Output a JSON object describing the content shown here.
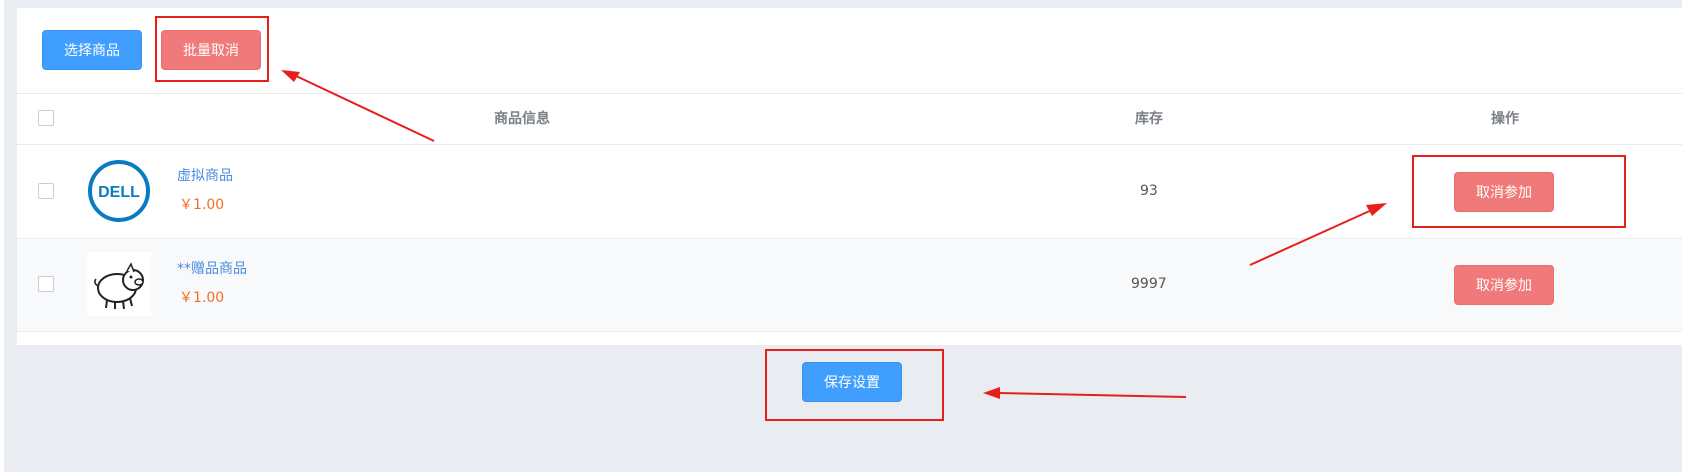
{
  "toolbar": {
    "select_label": "选择商品",
    "batch_cancel_label": "批量取消"
  },
  "table": {
    "headers": {
      "product_info": "商品信息",
      "stock": "库存",
      "action": "操作"
    },
    "rows": [
      {
        "logo": "dell-logo",
        "name": "虚拟商品",
        "price": "￥1.00",
        "stock": "93",
        "action_label": "取消参加"
      },
      {
        "logo": "pig-icon",
        "name": "**赠品商品",
        "price": "￥1.00",
        "stock": "9997",
        "action_label": "取消参加"
      }
    ]
  },
  "footer": {
    "save_label": "保存设置"
  },
  "colors": {
    "primary": "#409eff",
    "danger": "#f07a7a",
    "price": "#f07025",
    "link": "#4a8be0",
    "annotation": "#e5201b",
    "page_background": "#e9edf2"
  }
}
